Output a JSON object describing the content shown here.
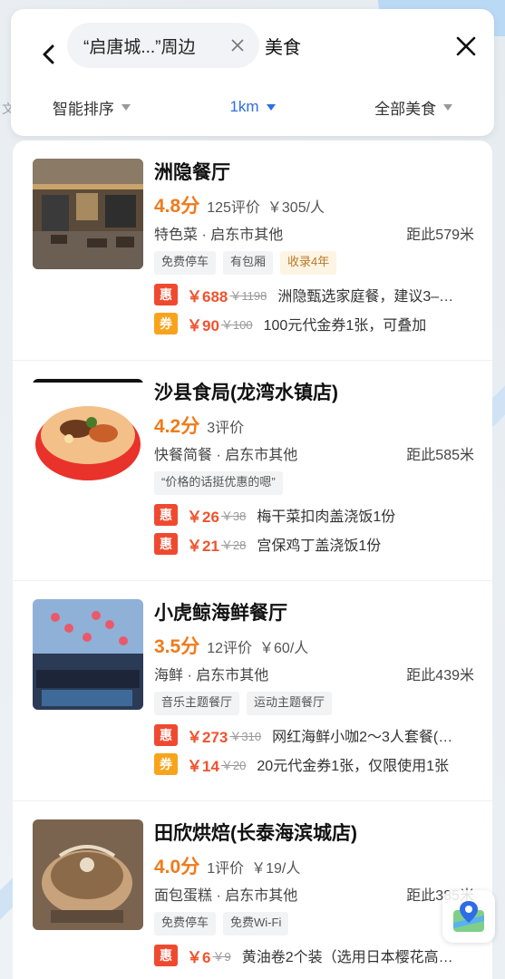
{
  "header": {
    "chip_text": "“启唐城...”周边",
    "query": "美食",
    "filters": [
      {
        "label": "智能排序",
        "active": false
      },
      {
        "label": "1km",
        "active": true
      },
      {
        "label": "全部美食",
        "active": false
      }
    ]
  },
  "map": {
    "edge_text": "文"
  },
  "restaurants": [
    {
      "name": "洲隐餐厅",
      "score": "4.8分",
      "reviews": "125评价",
      "price": "￥305/人",
      "category": "特色菜 · 启东市其他",
      "distance": "距此579米",
      "tags": [
        "免费停车",
        "有包厢",
        "收录4年"
      ],
      "deals": [
        {
          "badge": "惠",
          "price": "￥688",
          "orig": "￥1198",
          "desc": "洲隐甄选家庭餐，建议3–…"
        },
        {
          "badge": "券",
          "price": "￥90",
          "orig": "￥100",
          "desc": "100元代金券1张，可叠加"
        }
      ]
    },
    {
      "name": "沙县食局(龙湾水镇店)",
      "score": "4.2分",
      "reviews": "3评价",
      "price": "",
      "category": "快餐简餐 · 启东市其他",
      "distance": "距此585米",
      "tags": [
        "“价格的话挺优惠的嗯”"
      ],
      "deals": [
        {
          "badge": "惠",
          "price": "￥26",
          "orig": "￥38",
          "desc": "梅干菜扣肉盖浇饭1份"
        },
        {
          "badge": "惠",
          "price": "￥21",
          "orig": "￥28",
          "desc": "宫保鸡丁盖浇饭1份"
        }
      ]
    },
    {
      "name": "小虎鲸海鲜餐厅",
      "score": "3.5分",
      "reviews": "12评价",
      "price": "￥60/人",
      "category": "海鲜 · 启东市其他",
      "distance": "距此439米",
      "tags": [
        "音乐主题餐厅",
        "运动主题餐厅"
      ],
      "deals": [
        {
          "badge": "惠",
          "price": "￥273",
          "orig": "￥310",
          "desc": "网红海鲜小咖2～3人套餐(…"
        },
        {
          "badge": "券",
          "price": "￥14",
          "orig": "￥20",
          "desc": "20元代金券1张，仅限使用1张"
        }
      ]
    },
    {
      "name": "田欣烘焙(长泰海滨城店)",
      "score": "4.0分",
      "reviews": "1评价",
      "price": "￥19/人",
      "category": "面包蛋糕 · 启东市其他",
      "distance": "距此385米",
      "tags": [
        "免费停车",
        "免费Wi-Fi"
      ],
      "deals": [
        {
          "badge": "惠",
          "price": "￥6",
          "orig": "￥9",
          "desc": "黄油卷2个装（选用日本樱花高…"
        }
      ]
    }
  ],
  "colors": {
    "accent": "#2d6ee6",
    "score": "#f07a1a",
    "deal_red": "#ef4a2f",
    "coupon": "#f7a41c"
  },
  "icons": [
    "back-arrow-icon",
    "close-icon",
    "chip-close-icon",
    "caret-down-icon",
    "map-app-icon"
  ]
}
